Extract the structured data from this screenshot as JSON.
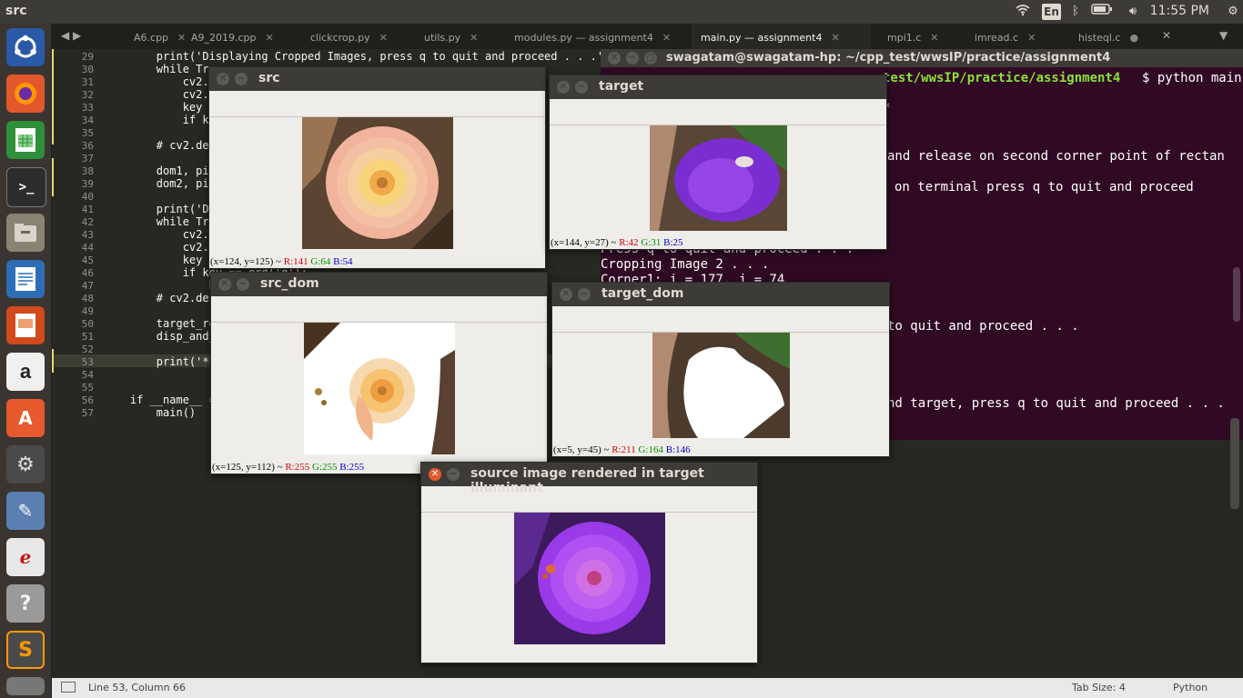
{
  "topbar": {
    "title": "src",
    "lang": "En",
    "clock": "11:55 PM",
    "icons": [
      "wifi-icon",
      "bluetooth-icon",
      "battery-icon",
      "volume-icon",
      "settings-gear-icon"
    ]
  },
  "tabs": [
    {
      "label": "A6.cpp"
    },
    {
      "label": "A9_2019.cpp"
    },
    {
      "label": "clickcrop.py"
    },
    {
      "label": "utils.py"
    },
    {
      "label": "modules.py — assignment4"
    },
    {
      "label": "main.py — assignment4"
    },
    {
      "label": "mpi1.c"
    },
    {
      "label": "imread.c"
    },
    {
      "label": "histeql.c"
    }
  ],
  "editor": {
    "lines": [
      {
        "n": "29",
        "code": "        print('Displaying Cropped Images, press q to quit and proceed . . .')"
      },
      {
        "n": "30",
        "code": "        while True:"
      },
      {
        "n": "31",
        "code": "            cv2.imshow"
      },
      {
        "n": "32",
        "code": "            cv2.imshow"
      },
      {
        "n": "33",
        "code": "            key = cv2"
      },
      {
        "n": "34",
        "code": "            if key =="
      },
      {
        "n": "35",
        "code": "                break"
      },
      {
        "n": "36",
        "code": "        # cv2.destroy"
      },
      {
        "n": "37",
        "code": ""
      },
      {
        "n": "38",
        "code": "        dom1, pixels1"
      },
      {
        "n": "39",
        "code": "        dom2, pixels2"
      },
      {
        "n": "40",
        "code": ""
      },
      {
        "n": "41",
        "code": "        print('Displa"
      },
      {
        "n": "42",
        "code": "        while True:"
      },
      {
        "n": "43",
        "code": "            cv2.imshow"
      },
      {
        "n": "44",
        "code": "            cv2.imshow"
      },
      {
        "n": "45",
        "code": "            key = cv"
      },
      {
        "n": "46",
        "code": "            if key == ord('q'):"
      },
      {
        "n": "47",
        "code": "                break"
      },
      {
        "n": "48",
        "code": "        # cv2.destroy"
      },
      {
        "n": "49",
        "code": ""
      },
      {
        "n": "50",
        "code": "        target_rec ="
      },
      {
        "n": "51",
        "code": "        disp_and_quit"
      },
      {
        "n": "52",
        "code": ""
      },
      {
        "n": "53",
        "code": "        print('*****"
      },
      {
        "n": "54",
        "code": ""
      },
      {
        "n": "55",
        "code": ""
      },
      {
        "n": "56",
        "code": "    if __name__ == '_"
      },
      {
        "n": "57",
        "code": "        main()"
      }
    ]
  },
  "terminal": {
    "title": "swagatam@swagatam-hp: ~/cpp_test/wwsIP/practice/assignment4",
    "prompt_path": "test/wwsIP/practice/assignment4",
    "prompt_cmd": "$ python main",
    "lines": [
      "*",
      "and release on second corner point of rectan",
      "on terminal press q to quit and proceed",
      "Press q to quit and proceed . . .",
      "Cropping Image 2 . . .",
      "Corner1: i = 177, j = 74",
      "to quit and proceed . . .",
      "nd target, press q to quit and proceed . . ."
    ]
  },
  "windows": {
    "src": {
      "title": "src",
      "x": "x=124",
      "y": "y=125",
      "sep": " ~ ",
      "R": "R:141",
      "G": "G:64",
      "B": "B:54"
    },
    "target": {
      "title": "target",
      "x": "x=144",
      "y": "y=27",
      "sep": " ~ ",
      "R": "R:42",
      "G": "G:31",
      "B": "B:25"
    },
    "src_dom": {
      "title": "src_dom",
      "x": "x=125",
      "y": "y=112",
      "sep": " ~ ",
      "R": "R:255",
      "G": "G:255",
      "B": "B:255"
    },
    "target_dom": {
      "title": "target_dom",
      "x": "x=5",
      "y": "y=45",
      "sep": " ~ ",
      "R": "R:211",
      "G": "G:164",
      "B": "B:146"
    },
    "render": {
      "title": "source image rendered in target illuminant"
    }
  },
  "status": {
    "position": "Line 53, Column 66",
    "tab_size": "Tab Size: 4",
    "syntax": "Python"
  }
}
